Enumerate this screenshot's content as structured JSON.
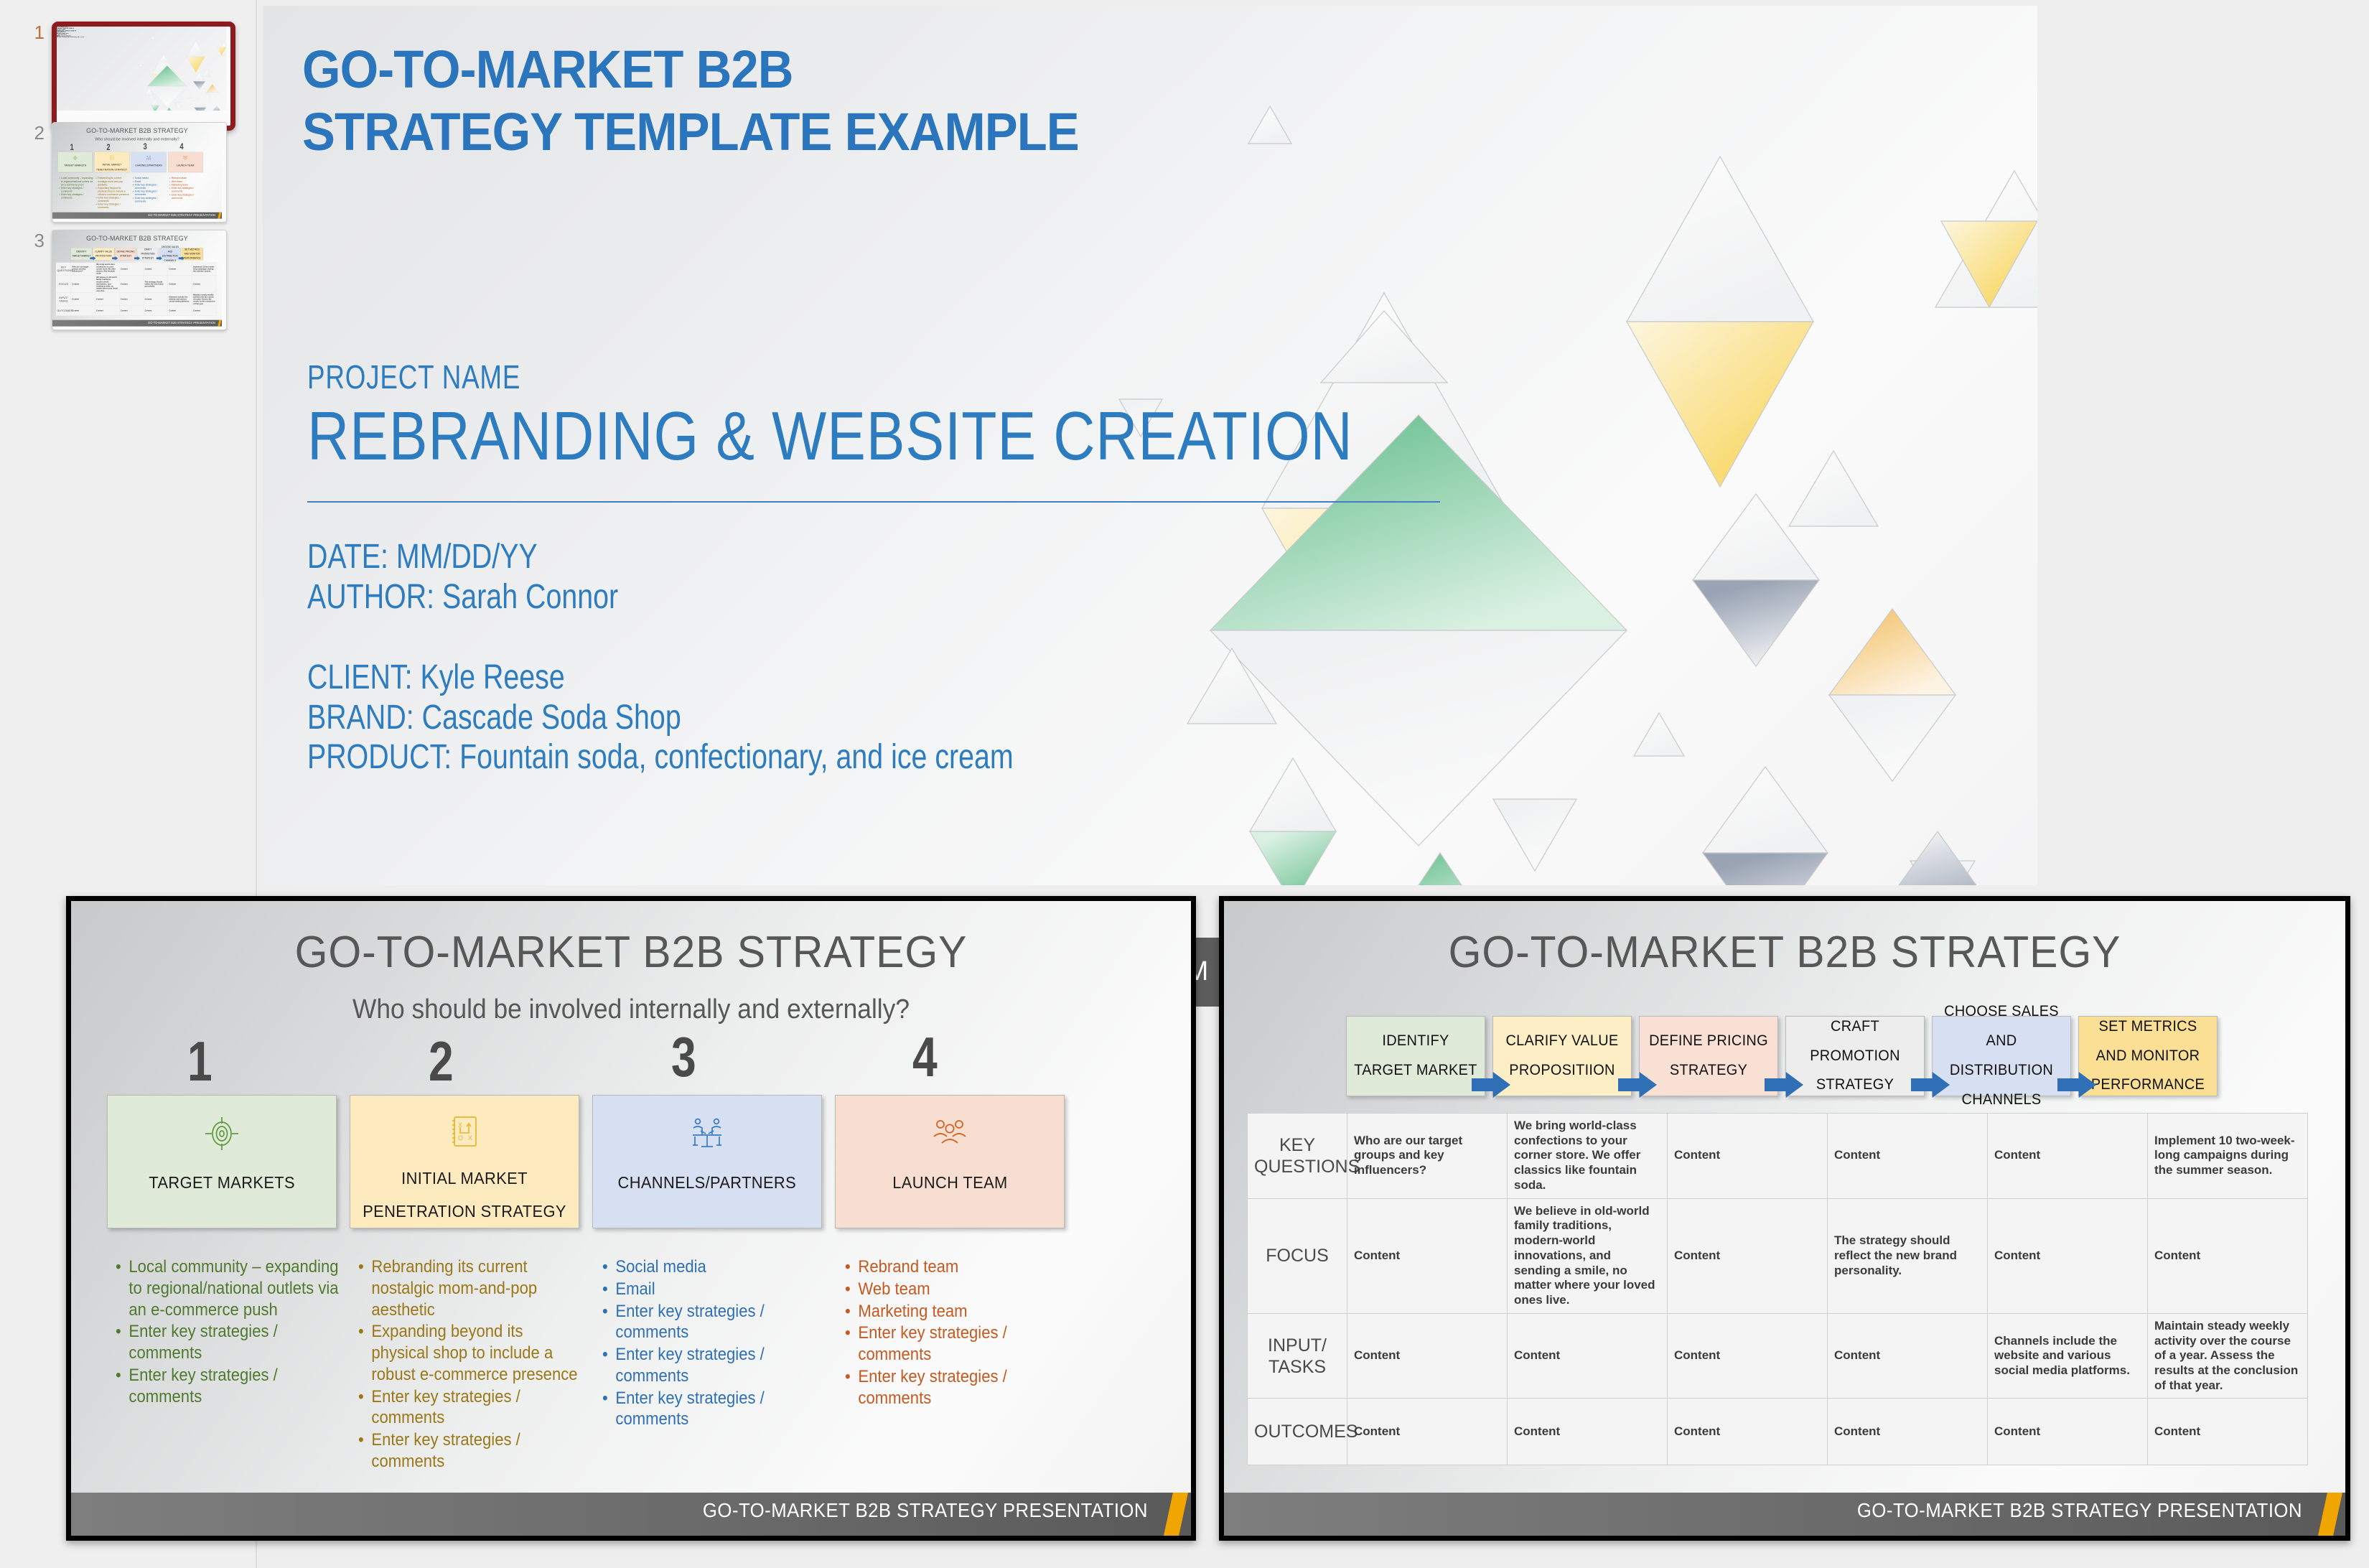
{
  "app": {
    "background_color": "#eeeeee",
    "accent_blue": "#2a75bb",
    "title_gray": "#575757"
  },
  "thumbnails": [
    {
      "number": "1",
      "selected": true
    },
    {
      "number": "2",
      "selected": false
    },
    {
      "number": "3",
      "selected": false
    }
  ],
  "slide1": {
    "title_line1": "GO-TO-MARKET B2B",
    "title_line2": "STRATEGY TEMPLATE EXAMPLE",
    "project_label": "PROJECT NAME",
    "project_name": "REBRANDING & WEBSITE CREATION",
    "date": "DATE: MM/DD/YY",
    "author": "AUTHOR: Sarah Connor",
    "client": "CLIENT: Kyle Reese",
    "brand": "BRAND: Cascade Soda Shop",
    "product": "PRODUCT: Fountain soda, confectionary, and ice cream"
  },
  "slide2": {
    "title": "GO-TO-MARKET B2B STRATEGY",
    "subtitle": "Who should be involved internally and externally?",
    "footer": "GO-TO-MARKET B2B STRATEGY PRESENTATION",
    "columns": [
      {
        "number": "1",
        "label": "TARGET MARKETS",
        "icon": "target-icon",
        "fill": "#dfead8",
        "text_color": "#4f7a2d",
        "bullets": [
          "Local community – expanding to regional/national outlets via an e-commerce push",
          "Enter key strategies / comments",
          "Enter key strategies / comments"
        ]
      },
      {
        "number": "2",
        "label": "INITIAL MARKET PENETRATION STRATEGY",
        "icon": "notebook-strategy-icon",
        "fill": "#fdeabf",
        "text_color": "#9c7718",
        "bullets": [
          "Rebranding its current nostalgic mom-and-pop aesthetic",
          "Expanding beyond its physical shop to include a robust e-commerce presence",
          "Enter key strategies / comments",
          "Enter key strategies / comments"
        ]
      },
      {
        "number": "3",
        "label": "CHANNELS/PARTNERS",
        "icon": "meeting-table-icon",
        "fill": "#d6e0f2",
        "text_color": "#2f6fb5",
        "bullets": [
          "Social media",
          "Email",
          "Enter key strategies / comments",
          "Enter key strategies / comments",
          "Enter key strategies / comments"
        ]
      },
      {
        "number": "4",
        "label": "LAUNCH TEAM",
        "icon": "people-group-icon",
        "fill": "#f8ded0",
        "text_color": "#c45a22",
        "bullets": [
          "Rebrand team",
          "Web team",
          "Marketing team",
          "Enter key strategies / comments",
          "Enter key strategies / comments"
        ]
      }
    ]
  },
  "slide3": {
    "title": "GO-TO-MARKET B2B STRATEGY",
    "footer": "GO-TO-MARKET B2B STRATEGY PRESENTATION",
    "process_steps": [
      {
        "label": "IDENTIFY TARGET MARKET",
        "fill": "#dfead8"
      },
      {
        "label": "CLARIFY VALUE PROPOSITIION",
        "fill": "#fdeec5"
      },
      {
        "label": "DEFINE PRICING STRATEGY",
        "fill": "#f9e0d4"
      },
      {
        "label": "CRAFT PROMOTION STRATEGY",
        "fill": "#ededee"
      },
      {
        "label": "CHOOSE SALES AND DISTRIBUTION CHANNELS",
        "fill": "#d6e0f2"
      },
      {
        "label": "SET METRICS AND MONITOR PERFORMANCE",
        "fill": "#fadf95"
      }
    ],
    "table_rows": [
      {
        "header": "KEY QUESTIONS",
        "cells": [
          "Who are our target groups and key influencers?",
          "We bring world-class confections to your corner store. We offer classics like fountain soda.",
          "Content",
          "Content",
          "Content",
          "Implement 10 two-week-long campaigns during the summer season."
        ]
      },
      {
        "header": "FOCUS",
        "cells": [
          "Content",
          "We believe in old-world family traditions, modern-world innovations, and sending a smile, no matter where your loved ones live.",
          "Content",
          "The strategy should reflect the new brand personality.",
          "Content",
          "Content"
        ]
      },
      {
        "header": "INPUT/ TASKS",
        "cells": [
          "Content",
          "Content",
          "Content",
          "Content",
          "Channels include the website and various social media platforms.",
          "Maintain steady weekly activity over the course of a year. Assess the results at the conclusion of that year."
        ]
      },
      {
        "header": "OUTCOMES",
        "cells": [
          "Content",
          "Content",
          "Content",
          "Content",
          "Content",
          "Content"
        ]
      }
    ]
  },
  "background_slide_sliver": {
    "visible_text": "-M"
  }
}
